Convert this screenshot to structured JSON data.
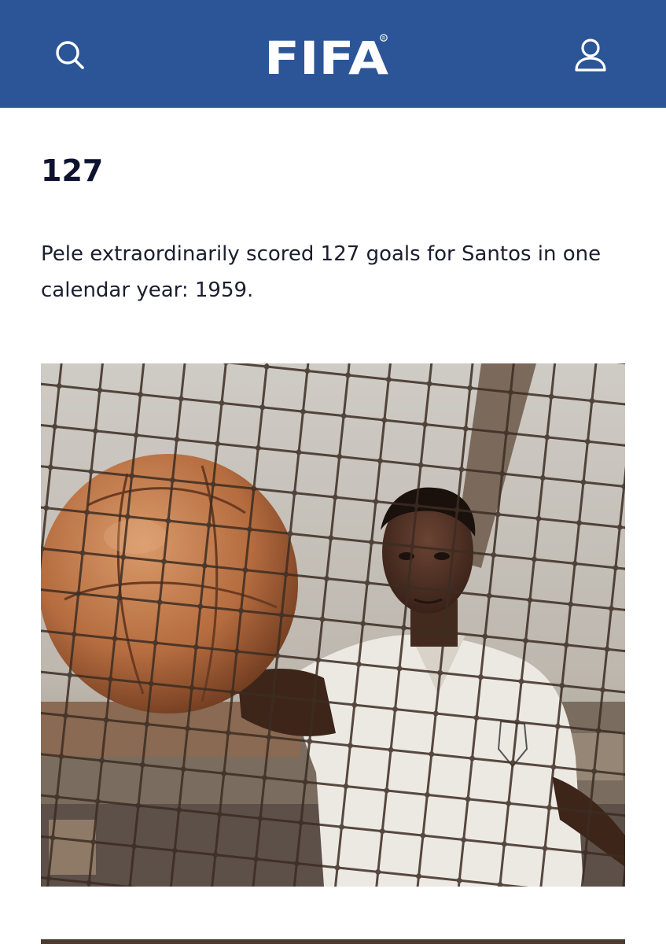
{
  "header": {
    "brand": "FIFA",
    "brand_color": "#2b5597",
    "icons": {
      "search": "search-icon",
      "account": "user-icon"
    }
  },
  "article": {
    "stat_title": "127",
    "paragraph": "Pele extraordinarily scored 127 goals for Santos in one calendar year: 1959.",
    "photo": {
      "subject": "pele-holding-ball-behind-goal-net"
    }
  }
}
